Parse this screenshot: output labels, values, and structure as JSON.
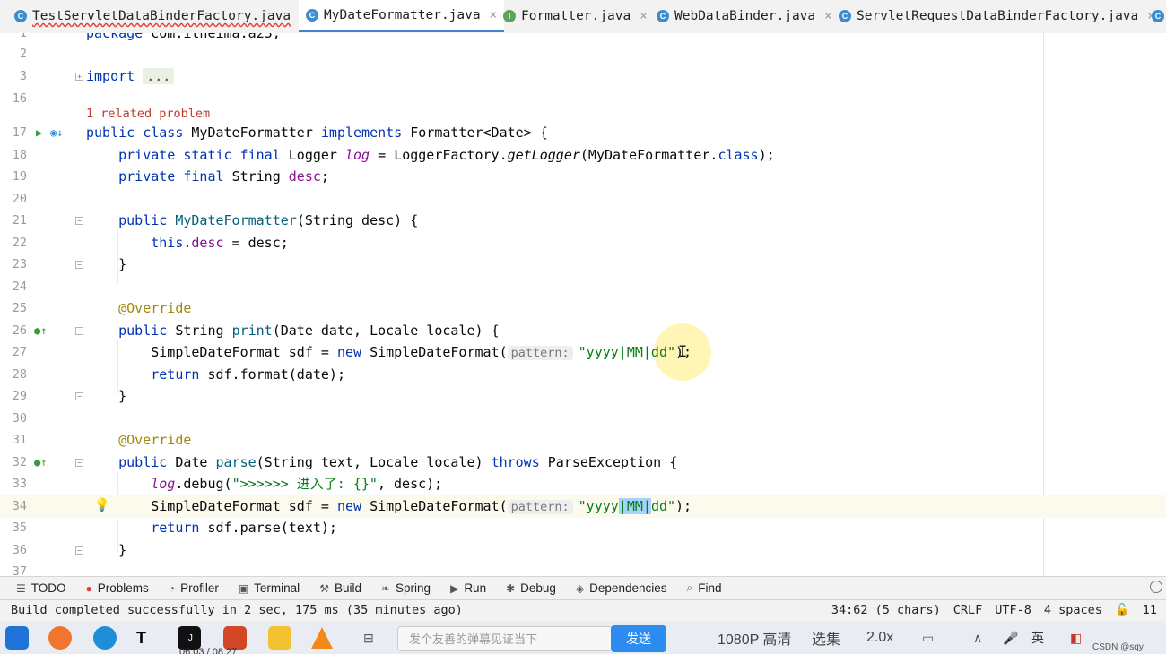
{
  "tabs": [
    {
      "label": "TestServletDataBinderFactory.java",
      "icon": "C",
      "active": false
    },
    {
      "label": "MyDateFormatter.java",
      "icon": "C",
      "active": true
    },
    {
      "label": "Formatter.java",
      "icon": "I",
      "active": false
    },
    {
      "label": "WebDataBinder.java",
      "icon": "C",
      "active": false
    },
    {
      "label": "ServletRequestDataBinderFactory.java",
      "icon": "C",
      "active": false
    }
  ],
  "tab_close_glyph": "×",
  "editor": {
    "line_numbers": [
      "1",
      "2",
      "3",
      "16",
      "17",
      "18",
      "19",
      "20",
      "21",
      "22",
      "23",
      "24",
      "25",
      "26",
      "27",
      "28",
      "29",
      "30",
      "31",
      "32",
      "33",
      "34",
      "35",
      "36",
      "37"
    ],
    "line1": [
      "package",
      " com.itheima.a23;"
    ],
    "import": [
      "import",
      "..."
    ],
    "problem": "1 related problem",
    "l17": [
      "public class",
      "MyDateFormatter",
      "implements",
      "Formatter<Date> {"
    ],
    "l18": [
      "private static final",
      "Logger",
      "log",
      "=",
      "LoggerFactory.",
      "getLogger",
      "(MyDateFormatter.",
      "class",
      ");"
    ],
    "l19": [
      "private final",
      "String",
      "desc",
      ";"
    ],
    "l21": [
      "public",
      "MyDateFormatter",
      "(String desc) {"
    ],
    "l22": [
      "this",
      ".",
      "desc",
      " = desc;"
    ],
    "brace": "}",
    "override": "@Override",
    "l26": [
      "public",
      "String",
      "print",
      "(Date date, Locale locale) {"
    ],
    "l27": [
      "SimpleDateFormat sdf = ",
      "new",
      " SimpleDateFormat(",
      "pattern:",
      "\"yyyy|MM|dd\"",
      ");"
    ],
    "l28": [
      "return",
      " sdf.format(date);"
    ],
    "l32": [
      "public",
      "Date",
      "parse",
      "(String text, Locale locale)",
      "throws",
      "ParseException {"
    ],
    "l33": [
      "log",
      ".debug(",
      "\">>>>>> 进入了: {}\"",
      ", desc);"
    ],
    "l34": [
      "SimpleDateFormat sdf = ",
      "new",
      " SimpleDateFormat(",
      "pattern:",
      "\"yyyy",
      "|MM|",
      "dd\"",
      ");"
    ],
    "l35": [
      "return",
      " sdf.parse(text);"
    ]
  },
  "tool_windows": [
    {
      "label": "TODO",
      "icon": "list-icon"
    },
    {
      "label": "Problems",
      "icon": "error-icon"
    },
    {
      "label": "Profiler",
      "icon": "profiler-icon"
    },
    {
      "label": "Terminal",
      "icon": "terminal-icon"
    },
    {
      "label": "Build",
      "icon": "hammer-icon"
    },
    {
      "label": "Spring",
      "icon": "leaf-icon"
    },
    {
      "label": "Run",
      "icon": "play-icon"
    },
    {
      "label": "Debug",
      "icon": "bug-icon"
    },
    {
      "label": "Dependencies",
      "icon": "layers-icon"
    },
    {
      "label": "Find",
      "icon": "search-icon"
    }
  ],
  "status": {
    "message": "Build completed successfully in 2 sec, 175 ms (35 minutes ago)",
    "position": "34:62 (5 chars)",
    "line_sep": "CRLF",
    "encoding": "UTF-8",
    "indent": "4 spaces",
    "extra": "11"
  },
  "taskbar": {
    "input_placeholder": "发个友善的弹幕见证当下",
    "send_label": "发送",
    "quality": "1080P 高清",
    "episodes": "选集",
    "speed": "2.0x",
    "time": "06:03 / 08:27",
    "watermark": "CSDN @sqy"
  },
  "colors": {
    "accent": "#4083c9",
    "keyword": "#0033b3",
    "string": "#067d17",
    "annotation": "#9e880d",
    "selection": "#a6d2ff"
  }
}
